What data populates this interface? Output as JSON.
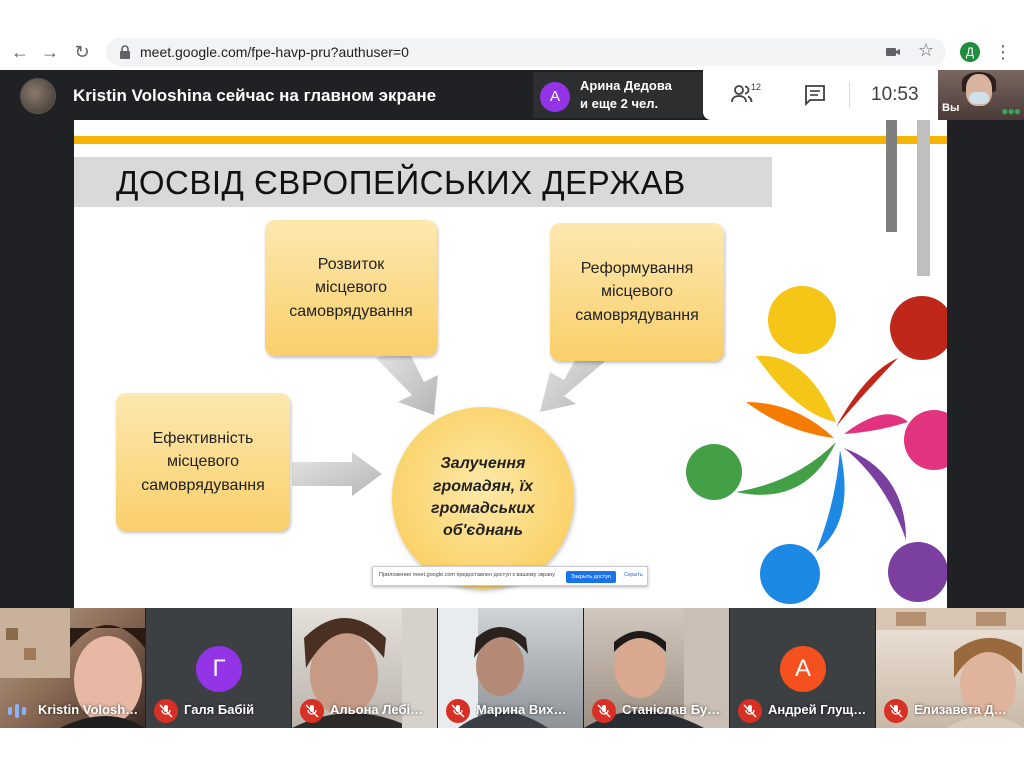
{
  "browser": {
    "url": "meet.google.com/fpe-havp-pru?authuser=0",
    "profile_initial": "Д"
  },
  "meet": {
    "presenter_text": "Kristin Voloshina сейчас на главном экране",
    "join_notice": {
      "initial": "А",
      "line1": "Арина Дедова",
      "line2": "и еще 2 чел."
    },
    "participants_count": "12",
    "time": "10:53",
    "self_label": "Вы"
  },
  "slide": {
    "title": "ДОСВІД ЄВРОПЕЙСЬКИХ ДЕРЖАВ",
    "box_top_left": "Розвиток\nмісцевого\nсамоврядування",
    "box_top_right": "Реформування\nмісцевого\nсамоврядування",
    "box_left": "Ефективність\nмісцевого\nсамоврядування",
    "center": "Залучення\nгромадян, їх\nгромадських\nоб'єднань"
  },
  "screen_share_notice": {
    "text": "Приложение meet.google.com предоставлен доступ к вашему экрану",
    "stop_button": "Закрыть доступ",
    "hide_link": "Скрыть"
  },
  "participants": [
    {
      "name": "Kristin Volosh…",
      "muted": false
    },
    {
      "name": "Галя Бабій",
      "initial": "Г",
      "avatar_color": "#9334e6",
      "muted": true
    },
    {
      "name": "Альона Лебі…",
      "muted": true
    },
    {
      "name": "Марина Вих…",
      "muted": true
    },
    {
      "name": "Станіслав Бу…",
      "muted": true
    },
    {
      "name": "Андрей Глущ…",
      "initial": "А",
      "avatar_color": "#f4511e",
      "muted": true
    },
    {
      "name": "Елизавета Д…",
      "muted": true
    }
  ]
}
